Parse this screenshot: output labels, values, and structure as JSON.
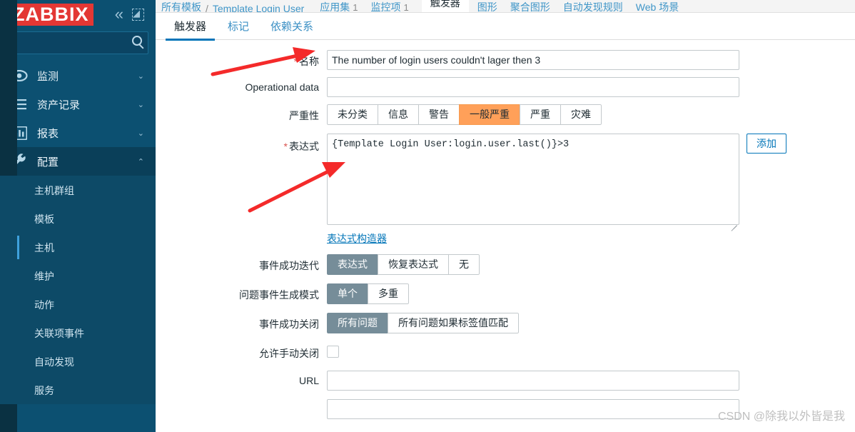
{
  "sidebar": {
    "logo": "ZABBIX",
    "collapse_icon": "chevron-double-left-icon",
    "compact_icon": "compact-view-icon",
    "search": {
      "value": "",
      "placeholder": ""
    },
    "groups": [
      {
        "icon": "eye-icon",
        "label": "监测",
        "chevron": "⌄",
        "expanded": false
      },
      {
        "icon": "list-icon",
        "label": "资产记录",
        "chevron": "⌄",
        "expanded": false
      },
      {
        "icon": "chart-bar-icon",
        "label": "报表",
        "chevron": "⌄",
        "expanded": false
      },
      {
        "icon": "wrench-icon",
        "label": "配置",
        "chevron": "⌃",
        "expanded": true
      }
    ],
    "sub_items": [
      {
        "label": "主机群组",
        "active": false
      },
      {
        "label": "模板",
        "active": false
      },
      {
        "label": "主机",
        "active": true
      },
      {
        "label": "维护",
        "active": false
      },
      {
        "label": "动作",
        "active": false
      },
      {
        "label": "关联项事件",
        "active": false
      },
      {
        "label": "自动发现",
        "active": false
      },
      {
        "label": "服务",
        "active": false
      }
    ]
  },
  "topnav": {
    "breadcrumb_root": "所有模板",
    "separator": "/",
    "breadcrumb_current": "Template Login User",
    "items": [
      {
        "label": "应用集",
        "count": "1",
        "active": false
      },
      {
        "label": "监控项",
        "count": "1",
        "active": false
      },
      {
        "label": "触发器",
        "count": "",
        "active": true
      },
      {
        "label": "图形",
        "count": "",
        "active": false
      },
      {
        "label": "聚合图形",
        "count": "",
        "active": false
      },
      {
        "label": "自动发现规则",
        "count": "",
        "active": false
      },
      {
        "label": "Web 场景",
        "count": "",
        "active": false
      }
    ]
  },
  "tabs": [
    {
      "label": "触发器",
      "active": true
    },
    {
      "label": "标记",
      "active": false
    },
    {
      "label": "依赖关系",
      "active": false
    }
  ],
  "form": {
    "name": {
      "label": "名称",
      "required": true,
      "value": "The number of login users couldn't lager then 3",
      "placeholder": ""
    },
    "operational_data": {
      "label": "Operational data",
      "required": false,
      "value": "",
      "placeholder": ""
    },
    "severity": {
      "label": "严重性",
      "options": [
        {
          "label": "未分类",
          "selected": false
        },
        {
          "label": "信息",
          "selected": false
        },
        {
          "label": "警告",
          "selected": false
        },
        {
          "label": "一般严重",
          "selected": true
        },
        {
          "label": "严重",
          "selected": false
        },
        {
          "label": "灾难",
          "selected": false
        }
      ]
    },
    "expression": {
      "label": "表达式",
      "required": true,
      "value": "{Template Login User:login.user.last()}>3",
      "placeholder": "",
      "add_button": "添加",
      "constructor_link": "表达式构造器"
    },
    "event_success_iteration": {
      "label": "事件成功迭代",
      "options": [
        {
          "label": "表达式",
          "selected": true
        },
        {
          "label": "恢复表达式",
          "selected": false
        },
        {
          "label": "无",
          "selected": false
        }
      ]
    },
    "problem_event_generation_mode": {
      "label": "问题事件生成模式",
      "options": [
        {
          "label": "单个",
          "selected": true
        },
        {
          "label": "多重",
          "selected": false
        }
      ]
    },
    "event_success_close": {
      "label": "事件成功关闭",
      "options": [
        {
          "label": "所有问题",
          "selected": true
        },
        {
          "label": "所有问题如果标签值匹配",
          "selected": false
        }
      ]
    },
    "allow_manual_close": {
      "label": "允许手动关闭",
      "checked": false
    },
    "url": {
      "label": "URL",
      "required": false,
      "value": "",
      "placeholder": ""
    },
    "description_partial": {
      "value": "",
      "placeholder": ""
    }
  },
  "colors": {
    "sidebar_bg": "#0c5071",
    "logo_bg": "#e33734",
    "accent": "#0275b8",
    "severity_selected": "#ffa059",
    "segment_selected": "#768d99",
    "annotation_arrow": "#f42a2a"
  },
  "watermark": "CSDN @除我以外皆是我"
}
